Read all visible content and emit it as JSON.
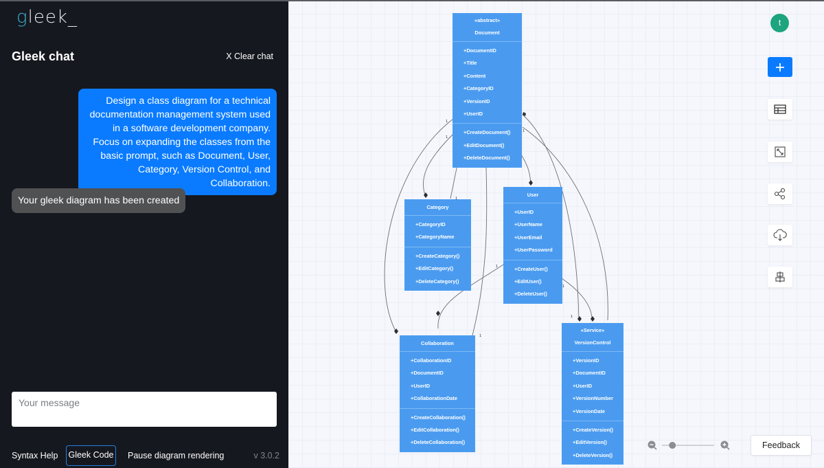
{
  "app": {
    "logo_g": "g",
    "logo_rest": "leek_"
  },
  "chat": {
    "title": "Gleek chat",
    "clear_label": "X Clear chat",
    "messages": [
      {
        "role": "user",
        "text": "Design a class diagram for a technical documentation management system used in a software development company. Focus on expanding the classes from the basic prompt, such as Document, User, Category, Version Control, and Collaboration."
      },
      {
        "role": "bot",
        "text": "Your gleek diagram has been created"
      }
    ],
    "input": {
      "value": "",
      "placeholder": "Your message"
    }
  },
  "footer": {
    "syntax_help": "Syntax Help",
    "gleek_code": "Gleek Code",
    "pause_rendering": "Pause diagram rendering",
    "version": "v 3.0.2"
  },
  "toolbar": {
    "avatar_initial": "t",
    "tools": [
      {
        "icon": "plus-icon",
        "label": "Add"
      },
      {
        "icon": "table-icon",
        "label": "Table"
      },
      {
        "icon": "fit-screen-icon",
        "label": "Fit"
      },
      {
        "icon": "share-icon",
        "label": "Share"
      },
      {
        "icon": "cloud-download-icon",
        "label": "Download"
      },
      {
        "icon": "align-center-icon",
        "label": "Layout"
      }
    ],
    "zoom_level": 0.2,
    "feedback_label": "Feedback"
  },
  "diagram": {
    "classes": {
      "document": {
        "stereotype": "«abstract»",
        "name": "Document",
        "attributes": [
          "+DocumentID",
          "+Title",
          "+Content",
          "+CategoryID",
          "+VersionID",
          "+UserID"
        ],
        "methods": [
          "+CreateDocument()",
          "+EditDocument()",
          "+DeleteDocument()"
        ]
      },
      "category": {
        "name": "Category",
        "attributes": [
          "+CategoryID",
          "+CategoryName"
        ],
        "methods": [
          "+CreateCategory()",
          "+EditCategory()",
          "+DeleteCategory()"
        ]
      },
      "user": {
        "name": "User",
        "attributes": [
          "+UserID",
          "+UserName",
          "+UserEmail",
          "+UserPassword"
        ],
        "methods": [
          "+CreateUser()",
          "+EditUser()",
          "+DeleteUser()"
        ]
      },
      "collaboration": {
        "name": "Collaboration",
        "attributes": [
          "+CollaborationID",
          "+DocumentID",
          "+UserID",
          "+CollaborationDate"
        ],
        "methods": [
          "+CreateCollaboration()",
          "+EditCollaboration()",
          "+DeleteCollaboration()"
        ]
      },
      "versioncontrol": {
        "stereotype": "«Service»",
        "name": "VersionControl",
        "attributes": [
          "+VersionID",
          "+DocumentID",
          "+UserID",
          "+VersionNumber",
          "+VersionDate"
        ],
        "methods": [
          "+CreateVersion()",
          "+EditVersion()",
          "+DeleteVersion()"
        ]
      }
    },
    "multiplicity_label": "1"
  }
}
